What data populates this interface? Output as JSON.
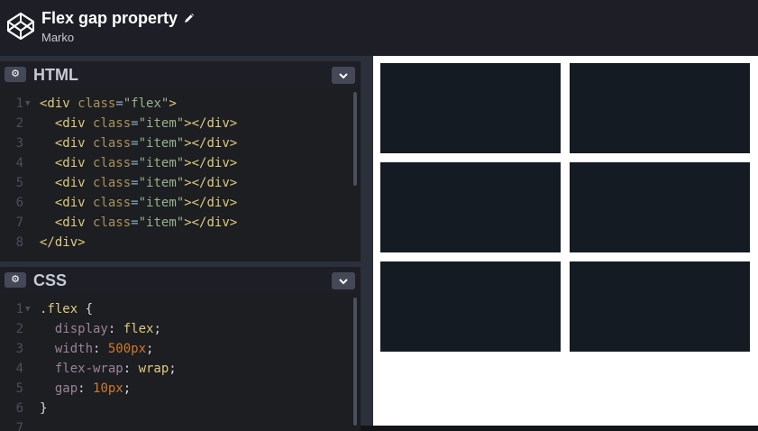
{
  "header": {
    "title": "Flex gap property",
    "author": "Marko",
    "logo_icon": "codepen-logo-icon",
    "edit_icon": "pencil-icon"
  },
  "html_panel": {
    "label": "HTML",
    "settings_icon": "gear-icon",
    "dropdown_icon": "chevron-down-icon",
    "lines": [
      {
        "n": "1",
        "fold": "▼",
        "tokens": [
          [
            "tag",
            "<div "
          ],
          [
            "attr",
            "class"
          ],
          [
            "punc",
            "="
          ],
          [
            "str",
            "\"flex\""
          ],
          [
            "tag",
            ">"
          ]
        ]
      },
      {
        "n": "2",
        "tokens": [
          [
            "plain",
            "  "
          ],
          [
            "tag",
            "<div "
          ],
          [
            "attr",
            "class"
          ],
          [
            "punc",
            "="
          ],
          [
            "str",
            "\"item\""
          ],
          [
            "tag",
            "></div>"
          ]
        ]
      },
      {
        "n": "3",
        "tokens": [
          [
            "plain",
            "  "
          ],
          [
            "tag",
            "<div "
          ],
          [
            "attr",
            "class"
          ],
          [
            "punc",
            "="
          ],
          [
            "str",
            "\"item\""
          ],
          [
            "tag",
            "></div>"
          ]
        ]
      },
      {
        "n": "4",
        "tokens": [
          [
            "plain",
            "  "
          ],
          [
            "tag",
            "<div "
          ],
          [
            "attr",
            "class"
          ],
          [
            "punc",
            "="
          ],
          [
            "str",
            "\"item\""
          ],
          [
            "tag",
            "></div>"
          ]
        ]
      },
      {
        "n": "5",
        "tokens": [
          [
            "plain",
            "  "
          ],
          [
            "tag",
            "<div "
          ],
          [
            "attr",
            "class"
          ],
          [
            "punc",
            "="
          ],
          [
            "str",
            "\"item\""
          ],
          [
            "tag",
            "></div>"
          ]
        ]
      },
      {
        "n": "6",
        "tokens": [
          [
            "plain",
            "  "
          ],
          [
            "tag",
            "<div "
          ],
          [
            "attr",
            "class"
          ],
          [
            "punc",
            "="
          ],
          [
            "str",
            "\"item\""
          ],
          [
            "tag",
            "></div>"
          ]
        ]
      },
      {
        "n": "7",
        "tokens": [
          [
            "plain",
            "  "
          ],
          [
            "tag",
            "<div "
          ],
          [
            "attr",
            "class"
          ],
          [
            "punc",
            "="
          ],
          [
            "str",
            "\"item\""
          ],
          [
            "tag",
            "></div>"
          ]
        ]
      },
      {
        "n": "8",
        "tokens": [
          [
            "tag",
            "</div>"
          ]
        ]
      }
    ]
  },
  "css_panel": {
    "label": "CSS",
    "settings_icon": "gear-icon",
    "dropdown_icon": "chevron-down-icon",
    "lines": [
      {
        "n": "1",
        "fold": "▼",
        "tokens": [
          [
            "tag",
            ".flex"
          ],
          [
            "plain",
            " {"
          ]
        ]
      },
      {
        "n": "2",
        "tokens": [
          [
            "plain",
            "  "
          ],
          [
            "prop",
            "display"
          ],
          [
            "plain",
            ": "
          ],
          [
            "val",
            "flex"
          ],
          [
            "plain",
            ";"
          ]
        ]
      },
      {
        "n": "3",
        "tokens": [
          [
            "plain",
            "  "
          ],
          [
            "prop",
            "width"
          ],
          [
            "plain",
            ": "
          ],
          [
            "num",
            "500px"
          ],
          [
            "plain",
            ";"
          ]
        ]
      },
      {
        "n": "4",
        "tokens": [
          [
            "plain",
            "  "
          ],
          [
            "prop",
            "flex-wrap"
          ],
          [
            "plain",
            ": "
          ],
          [
            "val",
            "wrap"
          ],
          [
            "plain",
            ";"
          ]
        ]
      },
      {
        "n": "5",
        "tokens": [
          [
            "plain",
            "  "
          ],
          [
            "prop",
            "gap"
          ],
          [
            "plain",
            ": "
          ],
          [
            "num",
            "10px"
          ],
          [
            "plain",
            ";"
          ]
        ]
      },
      {
        "n": "6",
        "tokens": [
          [
            "plain",
            "}"
          ]
        ]
      },
      {
        "n": "7",
        "tokens": []
      }
    ]
  },
  "preview": {
    "item_count": 6,
    "item_color": "#151b23",
    "background": "#ffffff"
  }
}
